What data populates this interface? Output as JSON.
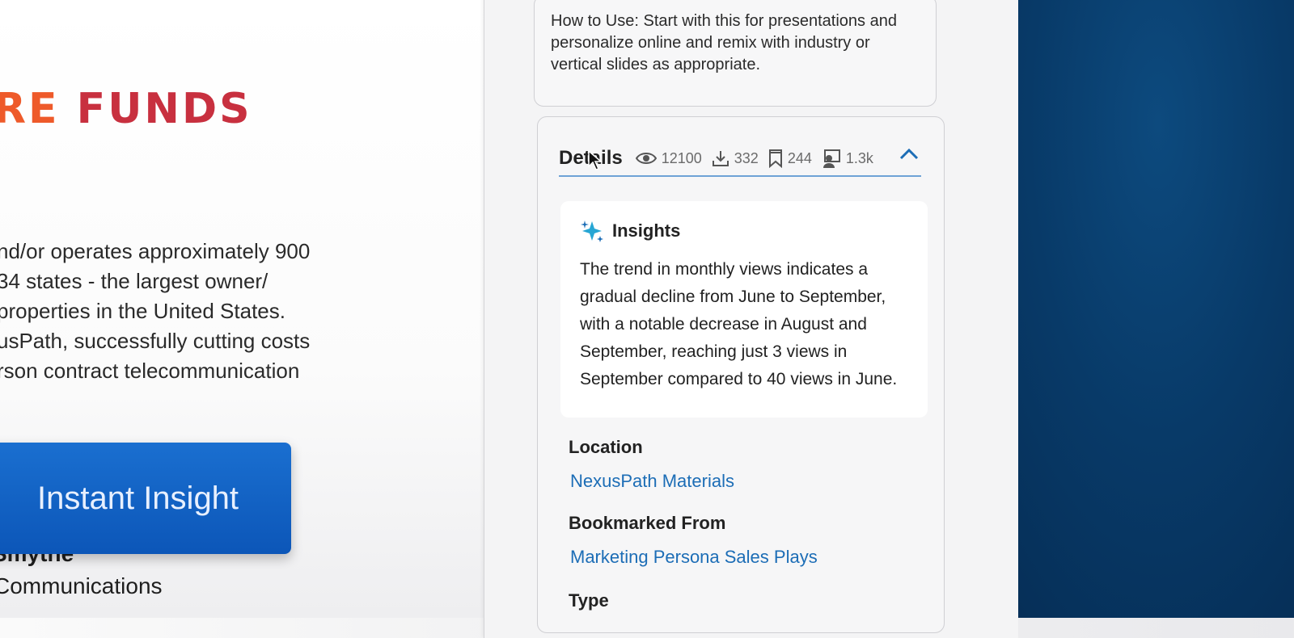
{
  "slide": {
    "logo_part1": "RE",
    "logo_part2": "FUNDS",
    "body_lines": [
      "nd/or operates approximately 900",
      "34 states - the largest owner/",
      "properties in the United States.",
      "usPath, successfully cutting costs",
      "rson contract telecommunication"
    ],
    "insight_button": "Instant Insight",
    "person_name": "Smythe",
    "person_title": "Communications"
  },
  "panel": {
    "how_to": "How to Use: Start with this for presentations and personalize online and remix with industry or vertical slides as appropriate.",
    "details": {
      "title": "Details",
      "views": "12100",
      "downloads": "332",
      "bookmarks": "244",
      "presentations": "1.3k",
      "insights_title": "Insights",
      "insights_text": "The trend in monthly views indicates a gradual decline from June to September, with a notable decrease in August and September, reaching just 3 views in September compared to 40 views in June.",
      "location_label": "Location",
      "location_value": "NexusPath Materials",
      "bookmarked_label": "Bookmarked From",
      "bookmarked_value": "Marketing Persona Sales Plays",
      "type_label": "Type"
    }
  },
  "colors": {
    "brand_orange": "#ee5a2a",
    "brand_red": "#c8303f",
    "button_blue": "#0c56b8",
    "link_blue": "#1c6db6",
    "bg_navy": "#083a68"
  },
  "icons": [
    "eye-icon",
    "download-icon",
    "bookmark-icon",
    "presenter-icon",
    "chevron-up-icon",
    "sparkle-icon",
    "mouse-cursor-icon"
  ]
}
